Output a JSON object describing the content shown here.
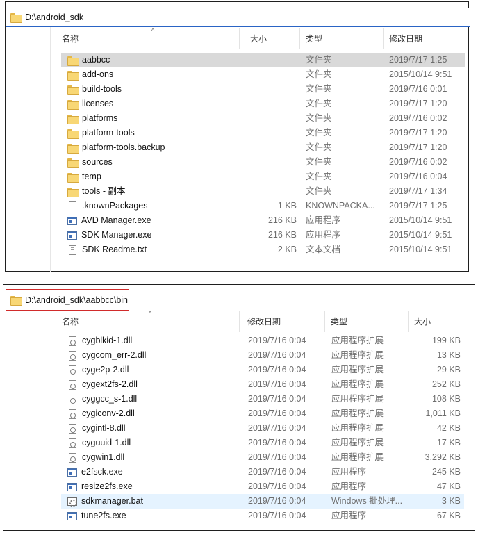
{
  "panel1": {
    "address": "D:\\android_sdk",
    "columns": {
      "name": "名称",
      "size": "大小",
      "type": "类型",
      "date": "修改日期"
    },
    "rows": [
      {
        "icon": "folder-icon",
        "name": "aabbcc",
        "size": "",
        "type": "文件夹",
        "date": "2019/7/17 1:25",
        "selected": true
      },
      {
        "icon": "folder-icon",
        "name": "add-ons",
        "size": "",
        "type": "文件夹",
        "date": "2015/10/14 9:51"
      },
      {
        "icon": "folder-icon",
        "name": "build-tools",
        "size": "",
        "type": "文件夹",
        "date": "2019/7/16 0:01"
      },
      {
        "icon": "folder-icon",
        "name": "licenses",
        "size": "",
        "type": "文件夹",
        "date": "2019/7/17 1:20"
      },
      {
        "icon": "folder-icon",
        "name": "platforms",
        "size": "",
        "type": "文件夹",
        "date": "2019/7/16 0:02"
      },
      {
        "icon": "folder-icon",
        "name": "platform-tools",
        "size": "",
        "type": "文件夹",
        "date": "2019/7/17 1:20"
      },
      {
        "icon": "folder-icon",
        "name": "platform-tools.backup",
        "size": "",
        "type": "文件夹",
        "date": "2019/7/17 1:20"
      },
      {
        "icon": "folder-icon",
        "name": "sources",
        "size": "",
        "type": "文件夹",
        "date": "2019/7/16 0:02"
      },
      {
        "icon": "folder-icon",
        "name": "temp",
        "size": "",
        "type": "文件夹",
        "date": "2019/7/16 0:04"
      },
      {
        "icon": "folder-icon",
        "name": "tools - 副本",
        "size": "",
        "type": "文件夹",
        "date": "2019/7/17 1:34"
      },
      {
        "icon": "file-icon",
        "name": ".knownPackages",
        "size": "1 KB",
        "type": "KNOWNPACKA...",
        "date": "2019/7/17 1:25"
      },
      {
        "icon": "exe-icon",
        "name": "AVD Manager.exe",
        "size": "216 KB",
        "type": "应用程序",
        "date": "2015/10/14 9:51"
      },
      {
        "icon": "exe-icon",
        "name": "SDK Manager.exe",
        "size": "216 KB",
        "type": "应用程序",
        "date": "2015/10/14 9:51"
      },
      {
        "icon": "txt-icon",
        "name": "SDK Readme.txt",
        "size": "2 KB",
        "type": "文本文档",
        "date": "2015/10/14 9:51"
      }
    ]
  },
  "panel2": {
    "address": "D:\\android_sdk\\aabbcc\\bin",
    "columns": {
      "name": "名称",
      "date": "修改日期",
      "type": "类型",
      "size": "大小"
    },
    "rows": [
      {
        "icon": "dll-icon",
        "name": "cygblkid-1.dll",
        "date": "2019/7/16 0:04",
        "type": "应用程序扩展",
        "size": "199 KB"
      },
      {
        "icon": "dll-icon",
        "name": "cygcom_err-2.dll",
        "date": "2019/7/16 0:04",
        "type": "应用程序扩展",
        "size": "13 KB"
      },
      {
        "icon": "dll-icon",
        "name": "cyge2p-2.dll",
        "date": "2019/7/16 0:04",
        "type": "应用程序扩展",
        "size": "29 KB"
      },
      {
        "icon": "dll-icon",
        "name": "cygext2fs-2.dll",
        "date": "2019/7/16 0:04",
        "type": "应用程序扩展",
        "size": "252 KB"
      },
      {
        "icon": "dll-icon",
        "name": "cyggcc_s-1.dll",
        "date": "2019/7/16 0:04",
        "type": "应用程序扩展",
        "size": "108 KB"
      },
      {
        "icon": "dll-icon",
        "name": "cygiconv-2.dll",
        "date": "2019/7/16 0:04",
        "type": "应用程序扩展",
        "size": "1,011 KB"
      },
      {
        "icon": "dll-icon",
        "name": "cygintl-8.dll",
        "date": "2019/7/16 0:04",
        "type": "应用程序扩展",
        "size": "42 KB"
      },
      {
        "icon": "dll-icon",
        "name": "cyguuid-1.dll",
        "date": "2019/7/16 0:04",
        "type": "应用程序扩展",
        "size": "17 KB"
      },
      {
        "icon": "dll-icon",
        "name": "cygwin1.dll",
        "date": "2019/7/16 0:04",
        "type": "应用程序扩展",
        "size": "3,292 KB"
      },
      {
        "icon": "exe-icon",
        "name": "e2fsck.exe",
        "date": "2019/7/16 0:04",
        "type": "应用程序",
        "size": "245 KB"
      },
      {
        "icon": "exe-icon",
        "name": "resize2fs.exe",
        "date": "2019/7/16 0:04",
        "type": "应用程序",
        "size": "47 KB"
      },
      {
        "icon": "bat-icon",
        "name": "sdkmanager.bat",
        "date": "2019/7/16 0:04",
        "type": "Windows 批处理...",
        "size": "3 KB",
        "hover": true
      },
      {
        "icon": "exe-icon",
        "name": "tune2fs.exe",
        "date": "2019/7/16 0:04",
        "type": "应用程序",
        "size": "67 KB"
      }
    ]
  }
}
